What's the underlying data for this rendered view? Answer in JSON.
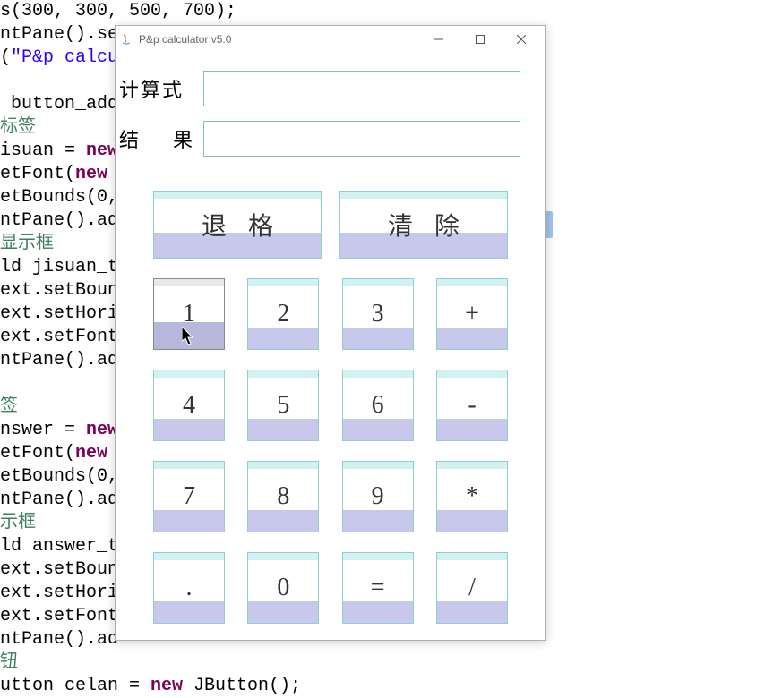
{
  "window": {
    "title": "P&p calculator v5.0"
  },
  "labels": {
    "expression": "计算式",
    "result_char1": "结",
    "result_char2": "果"
  },
  "fields": {
    "expression_value": "",
    "result_value": ""
  },
  "buttons": {
    "backspace": "退格",
    "clear": "清除",
    "k1": "1",
    "k2": "2",
    "k3": "3",
    "plus": "+",
    "k4": "4",
    "k5": "5",
    "k6": "6",
    "minus": "-",
    "k7": "7",
    "k8": "8",
    "k9": "9",
    "mul": "*",
    "dot": ".",
    "k0": "0",
    "eq": "=",
    "div": "/"
  },
  "code_lines": [
    {
      "pre": "s(300, 300, 500, 700);"
    },
    {
      "pre": "ntPane().se"
    },
    {
      "pre": "(",
      "str": "\"P&p calcu"
    },
    {
      "pre": ""
    },
    {
      "pre": " button_add"
    },
    {
      "comment": "标签"
    },
    {
      "pre": "isuan = ",
      "kw": "new"
    },
    {
      "pre": "etFont(",
      "kw": "new"
    },
    {
      "pre": "etBounds(0,"
    },
    {
      "pre": "ntPane().ad"
    },
    {
      "comment": "显示框"
    },
    {
      "pre": "ld jisuan_t"
    },
    {
      "pre": "ext.setBoun"
    },
    {
      "pre": "ext.setHori"
    },
    {
      "pre": "ext.setFont"
    },
    {
      "pre": "ntPane().ad"
    },
    {
      "pre": ""
    },
    {
      "comment": "签"
    },
    {
      "pre": "nswer = ",
      "kw": "new"
    },
    {
      "pre": "etFont(",
      "kw": "new"
    },
    {
      "pre": "etBounds(0,"
    },
    {
      "pre": "ntPane().ad"
    },
    {
      "comment": "示框"
    },
    {
      "pre": "ld answer_t"
    },
    {
      "pre": "ext.setBoun"
    },
    {
      "pre": "ext.setHori"
    },
    {
      "pre": "ext.setFont"
    },
    {
      "pre": "ntPane().ad"
    },
    {
      "comment": "钮"
    },
    {
      "pre": "utton celan = ",
      "kw": "new",
      "post": " JButton();"
    }
  ]
}
